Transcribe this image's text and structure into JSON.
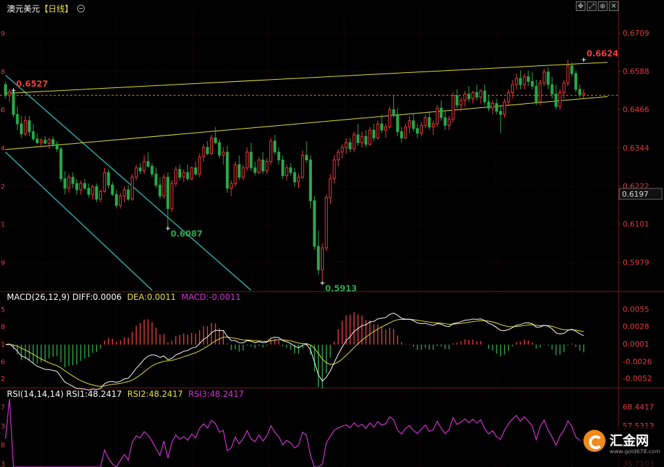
{
  "header": {
    "symbol": "澳元美元",
    "period": "【日线】",
    "toggle_icon": "circle-minus-icon",
    "toolbar_icons": [
      "move-icon",
      "expand-icon",
      "zoom-icon",
      "close-icon"
    ]
  },
  "macd_header": {
    "label": "MACD(26,12,9)",
    "diff": "DIFF:0.0006",
    "dea": "DEA:0.0011",
    "macd": "MACD:-0.0011"
  },
  "rsi_header": {
    "label": "RSI(14,14,14)",
    "rsi1": "RSI1:48.2417",
    "rsi2": "RSI2:48.2417",
    "rsi3": "RSI3:48.2417"
  },
  "watermark": {
    "brand": "汇金网",
    "url": "www.gold678.com"
  },
  "colors": {
    "up": "#ef3b3b",
    "down": "#2aa84a",
    "channel": "#e8e23c",
    "down_channel": "#2f9ea0",
    "dashed": "#ef6a2a",
    "dea": "#e8e23c",
    "diff": "#ffffff",
    "rsi": "#d531d5",
    "axis_text": "#e83a3a",
    "grid": "#3a1010"
  },
  "chart_data": [
    {
      "type": "candlestick",
      "title": "澳元美元 日线",
      "ylim": [
        0.589,
        0.6775
      ],
      "yticks": [
        0.6709,
        0.6588,
        0.6466,
        0.6344,
        0.6222,
        0.6101,
        0.5979
      ],
      "left_tick_stubs": [
        "9",
        "8",
        "6",
        "4",
        "2",
        "1",
        "9"
      ],
      "current_price": 0.6197,
      "annotations": [
        {
          "label": "0.6527",
          "index": 2,
          "price": 0.6527,
          "color": "#ef3b3b"
        },
        {
          "label": "0.6087",
          "index": 41,
          "price": 0.6087,
          "color": "#2aa84a"
        },
        {
          "label": "0.5913",
          "index": 80,
          "price": 0.5913,
          "color": "#2aa84a"
        },
        {
          "label": "0.6624",
          "index": 146,
          "price": 0.6624,
          "color": "#ef3b3b"
        }
      ],
      "reference_line": {
        "price": 0.6511,
        "style": "dashed"
      },
      "upper_channel": {
        "from": [
          0,
          0.6517
        ],
        "to": [
          152,
          0.6616
        ]
      },
      "lower_channel": {
        "from": [
          0,
          0.6338
        ],
        "to": [
          152,
          0.6507
        ]
      },
      "downtrend_lines": [
        {
          "from": [
            0,
            0.6575
          ],
          "to": [
            62,
            0.589
          ]
        },
        {
          "from": [
            0,
            0.633
          ],
          "to": [
            37,
            0.589
          ]
        }
      ],
      "candles": [
        [
          0.6545,
          0.6555,
          0.65,
          0.651
        ],
        [
          0.651,
          0.653,
          0.649,
          0.6522
        ],
        [
          0.6522,
          0.6527,
          0.644,
          0.645
        ],
        [
          0.645,
          0.6475,
          0.64,
          0.642
        ],
        [
          0.642,
          0.6445,
          0.6375,
          0.6388
        ],
        [
          0.6388,
          0.6445,
          0.638,
          0.643
        ],
        [
          0.643,
          0.6445,
          0.638,
          0.6395
        ],
        [
          0.6395,
          0.642,
          0.6365,
          0.6372
        ],
        [
          0.6372,
          0.639,
          0.6355,
          0.636
        ],
        [
          0.636,
          0.6375,
          0.6345,
          0.6368
        ],
        [
          0.6368,
          0.638,
          0.6355,
          0.6358
        ],
        [
          0.6358,
          0.6375,
          0.634,
          0.637
        ],
        [
          0.637,
          0.638,
          0.6345,
          0.6355
        ],
        [
          0.6355,
          0.6365,
          0.633,
          0.634
        ],
        [
          0.634,
          0.6345,
          0.6235,
          0.6245
        ],
        [
          0.6245,
          0.627,
          0.6195,
          0.6215
        ],
        [
          0.6215,
          0.626,
          0.62,
          0.625
        ],
        [
          0.625,
          0.6265,
          0.6215,
          0.623
        ],
        [
          0.623,
          0.6245,
          0.6195,
          0.621
        ],
        [
          0.621,
          0.624,
          0.6195,
          0.623
        ],
        [
          0.623,
          0.6245,
          0.621,
          0.6215
        ],
        [
          0.6215,
          0.623,
          0.6185,
          0.6195
        ],
        [
          0.6195,
          0.6225,
          0.618,
          0.622
        ],
        [
          0.622,
          0.623,
          0.617,
          0.618
        ],
        [
          0.618,
          0.621,
          0.617,
          0.6205
        ],
        [
          0.6205,
          0.628,
          0.62,
          0.6265
        ],
        [
          0.6265,
          0.6275,
          0.6215,
          0.6225
        ],
        [
          0.6225,
          0.6235,
          0.619,
          0.6195
        ],
        [
          0.6195,
          0.621,
          0.615,
          0.616
        ],
        [
          0.616,
          0.62,
          0.615,
          0.619
        ],
        [
          0.619,
          0.622,
          0.617,
          0.621
        ],
        [
          0.621,
          0.6225,
          0.6175,
          0.618
        ],
        [
          0.618,
          0.626,
          0.6175,
          0.625
        ],
        [
          0.625,
          0.629,
          0.624,
          0.628
        ],
        [
          0.628,
          0.6295,
          0.626,
          0.627
        ],
        [
          0.627,
          0.632,
          0.626,
          0.63
        ],
        [
          0.63,
          0.633,
          0.628,
          0.6285
        ],
        [
          0.6285,
          0.6295,
          0.625,
          0.626
        ],
        [
          0.626,
          0.628,
          0.6215,
          0.6225
        ],
        [
          0.6225,
          0.625,
          0.618,
          0.619
        ],
        [
          0.619,
          0.626,
          0.618,
          0.625
        ],
        [
          0.625,
          0.6265,
          0.6087,
          0.615
        ],
        [
          0.615,
          0.624,
          0.614,
          0.623
        ],
        [
          0.623,
          0.6285,
          0.622,
          0.6275
        ],
        [
          0.6275,
          0.629,
          0.624,
          0.625
        ],
        [
          0.625,
          0.6275,
          0.6235,
          0.6265
        ],
        [
          0.6265,
          0.629,
          0.624,
          0.6245
        ],
        [
          0.6245,
          0.6285,
          0.624,
          0.628
        ],
        [
          0.628,
          0.63,
          0.6255,
          0.626
        ],
        [
          0.626,
          0.6325,
          0.625,
          0.6315
        ],
        [
          0.6315,
          0.6355,
          0.63,
          0.6345
        ],
        [
          0.6345,
          0.6365,
          0.632,
          0.6325
        ],
        [
          0.6325,
          0.6385,
          0.632,
          0.6375
        ],
        [
          0.6375,
          0.641,
          0.6355,
          0.636
        ],
        [
          0.636,
          0.637,
          0.631,
          0.632
        ],
        [
          0.632,
          0.6345,
          0.629,
          0.633
        ],
        [
          0.633,
          0.635,
          0.62,
          0.6215
        ],
        [
          0.6215,
          0.624,
          0.619,
          0.623
        ],
        [
          0.623,
          0.63,
          0.622,
          0.629
        ],
        [
          0.629,
          0.632,
          0.624,
          0.625
        ],
        [
          0.625,
          0.629,
          0.624,
          0.628
        ],
        [
          0.628,
          0.6345,
          0.627,
          0.633
        ],
        [
          0.633,
          0.636,
          0.627,
          0.628
        ],
        [
          0.628,
          0.63,
          0.6255,
          0.6265
        ],
        [
          0.6265,
          0.6315,
          0.626,
          0.6305
        ],
        [
          0.6305,
          0.633,
          0.626,
          0.627
        ],
        [
          0.627,
          0.631,
          0.626,
          0.63
        ],
        [
          0.63,
          0.6375,
          0.629,
          0.6365
        ],
        [
          0.6365,
          0.6385,
          0.632,
          0.633
        ],
        [
          0.633,
          0.6345,
          0.629,
          0.6305
        ],
        [
          0.6305,
          0.632,
          0.6245,
          0.6255
        ],
        [
          0.6255,
          0.629,
          0.624,
          0.628
        ],
        [
          0.628,
          0.6295,
          0.6255,
          0.6265
        ],
        [
          0.6265,
          0.628,
          0.622,
          0.6235
        ],
        [
          0.6235,
          0.626,
          0.6215,
          0.625
        ],
        [
          0.625,
          0.6335,
          0.6245,
          0.632
        ],
        [
          0.632,
          0.6365,
          0.6295,
          0.6305
        ],
        [
          0.6305,
          0.632,
          0.615,
          0.6175
        ],
        [
          0.6175,
          0.619,
          0.602,
          0.603
        ],
        [
          0.603,
          0.608,
          0.594,
          0.5955
        ],
        [
          0.5955,
          0.604,
          0.5913,
          0.6025
        ],
        [
          0.6025,
          0.6195,
          0.6015,
          0.6185
        ],
        [
          0.6185,
          0.626,
          0.6165,
          0.6245
        ],
        [
          0.6245,
          0.632,
          0.623,
          0.6305
        ],
        [
          0.6305,
          0.634,
          0.6285,
          0.633
        ],
        [
          0.633,
          0.6355,
          0.631,
          0.6345
        ],
        [
          0.6345,
          0.6375,
          0.6325,
          0.636
        ],
        [
          0.636,
          0.6375,
          0.633,
          0.634
        ],
        [
          0.634,
          0.6395,
          0.633,
          0.6385
        ],
        [
          0.6385,
          0.642,
          0.635,
          0.636
        ],
        [
          0.636,
          0.6395,
          0.6345,
          0.638
        ],
        [
          0.638,
          0.64,
          0.6345,
          0.6355
        ],
        [
          0.6355,
          0.641,
          0.635,
          0.64
        ],
        [
          0.64,
          0.642,
          0.6365,
          0.6375
        ],
        [
          0.6375,
          0.643,
          0.637,
          0.642
        ],
        [
          0.642,
          0.645,
          0.639,
          0.64
        ],
        [
          0.64,
          0.642,
          0.6375,
          0.641
        ],
        [
          0.641,
          0.6475,
          0.6405,
          0.6465
        ],
        [
          0.6465,
          0.651,
          0.644,
          0.645
        ],
        [
          0.645,
          0.647,
          0.638,
          0.6395
        ],
        [
          0.6395,
          0.641,
          0.636,
          0.6375
        ],
        [
          0.6375,
          0.642,
          0.637,
          0.641
        ],
        [
          0.641,
          0.6445,
          0.639,
          0.643
        ],
        [
          0.643,
          0.6455,
          0.6395,
          0.6405
        ],
        [
          0.6405,
          0.642,
          0.6375,
          0.639
        ],
        [
          0.639,
          0.6425,
          0.638,
          0.6415
        ],
        [
          0.6415,
          0.645,
          0.6405,
          0.644
        ],
        [
          0.644,
          0.646,
          0.64,
          0.641
        ],
        [
          0.641,
          0.643,
          0.6385,
          0.642
        ],
        [
          0.642,
          0.648,
          0.641,
          0.647
        ],
        [
          0.647,
          0.6495,
          0.643,
          0.644
        ],
        [
          0.644,
          0.646,
          0.64,
          0.6415
        ],
        [
          0.6415,
          0.6445,
          0.64,
          0.6435
        ],
        [
          0.6435,
          0.652,
          0.6425,
          0.651
        ],
        [
          0.651,
          0.653,
          0.647,
          0.648
        ],
        [
          0.648,
          0.6505,
          0.646,
          0.6495
        ],
        [
          0.6495,
          0.6525,
          0.6475,
          0.6515
        ],
        [
          0.6515,
          0.654,
          0.649,
          0.65
        ],
        [
          0.65,
          0.6525,
          0.6485,
          0.652
        ],
        [
          0.652,
          0.6545,
          0.6495,
          0.6505
        ],
        [
          0.6505,
          0.653,
          0.6485,
          0.6525
        ],
        [
          0.6525,
          0.6545,
          0.648,
          0.649
        ],
        [
          0.649,
          0.651,
          0.646,
          0.647
        ],
        [
          0.647,
          0.6495,
          0.645,
          0.6485
        ],
        [
          0.6485,
          0.65,
          0.645,
          0.646
        ],
        [
          0.646,
          0.648,
          0.639,
          0.645
        ],
        [
          0.645,
          0.65,
          0.644,
          0.649
        ],
        [
          0.649,
          0.653,
          0.648,
          0.652
        ],
        [
          0.652,
          0.656,
          0.65,
          0.6545
        ],
        [
          0.6545,
          0.658,
          0.653,
          0.6565
        ],
        [
          0.6565,
          0.659,
          0.653,
          0.6545
        ],
        [
          0.6545,
          0.658,
          0.653,
          0.657
        ],
        [
          0.657,
          0.659,
          0.654,
          0.6555
        ],
        [
          0.6555,
          0.6585,
          0.653,
          0.654
        ],
        [
          0.654,
          0.656,
          0.648,
          0.649
        ],
        [
          0.649,
          0.656,
          0.648,
          0.655
        ],
        [
          0.655,
          0.6595,
          0.654,
          0.6585
        ],
        [
          0.6585,
          0.66,
          0.653,
          0.6545
        ],
        [
          0.6545,
          0.657,
          0.65,
          0.6515
        ],
        [
          0.6515,
          0.6545,
          0.6465,
          0.6475
        ],
        [
          0.6475,
          0.653,
          0.6465,
          0.652
        ],
        [
          0.652,
          0.656,
          0.65,
          0.655
        ],
        [
          0.655,
          0.6624,
          0.654,
          0.6605
        ],
        [
          0.6605,
          0.6615,
          0.657,
          0.658
        ],
        [
          0.658,
          0.659,
          0.652,
          0.653
        ],
        [
          0.653,
          0.6545,
          0.6505,
          0.6512
        ],
        [
          0.6512,
          0.653,
          0.65,
          0.6518
        ]
      ]
    },
    {
      "type": "macd",
      "params": "(26,12,9)",
      "diff": 0.0006,
      "dea": 0.0011,
      "macd": -0.0011,
      "yticks": [
        0.0055,
        0.0028,
        0.0001,
        -0.0026,
        -0.0052
      ],
      "left_tick_stubs": [
        "5",
        "8",
        "1",
        "6",
        "2"
      ],
      "ylim": [
        -0.0065,
        0.0065
      ]
    },
    {
      "type": "rsi",
      "params": "(14,14,14)",
      "rsi1": 48.2417,
      "rsi2": 48.2417,
      "rsi3": 48.2417,
      "yticks": [
        68.4417,
        57.5313,
        46.6208,
        35.7103
      ],
      "visible_ytick_labels": [
        "68.4417",
        "57.5313",
        "35.7103"
      ],
      "left_tick_stubs": [
        "7",
        "3",
        "8",
        "3"
      ],
      "ylim": [
        33.8,
        73.0
      ]
    }
  ]
}
